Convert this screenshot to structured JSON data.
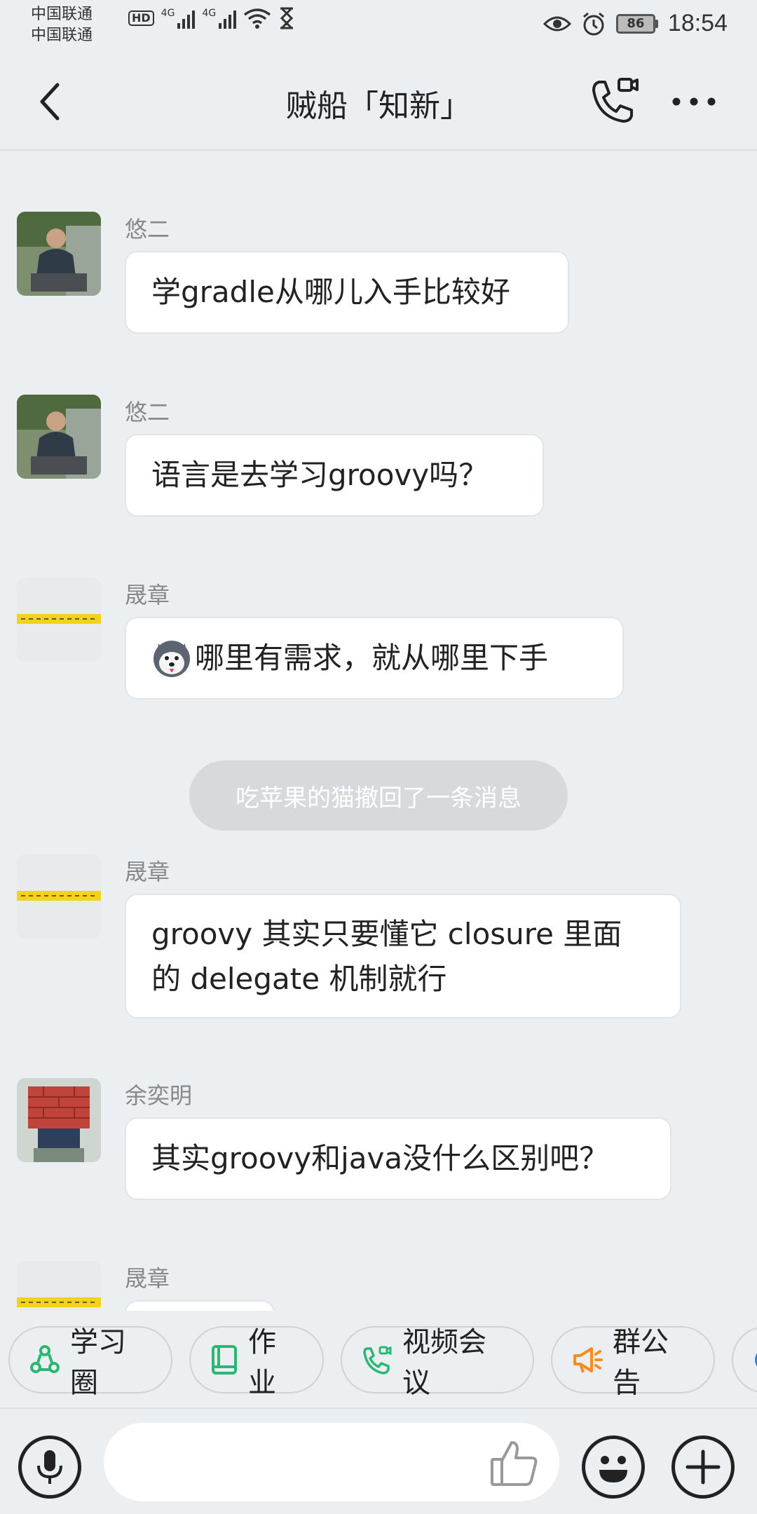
{
  "status_bar": {
    "carrier_1": "中国联通",
    "carrier_2": "中国联通",
    "hd": "HD",
    "net_1": "4G",
    "net_2": "4G",
    "battery": "86",
    "time": "18:54"
  },
  "header": {
    "title": "贼船「知新」"
  },
  "messages": [
    {
      "sender": "悠二",
      "text": "学gradle从哪儿入手比较好"
    },
    {
      "sender": "悠二",
      "text": "语言是去学习groovy吗？"
    },
    {
      "sender": "晟章",
      "text": "哪里有需求，就从哪里下手"
    },
    {
      "system": "吃苹果的猫撤回了一条消息"
    },
    {
      "sender": "晟章",
      "text_line1": "groovy 其实只要懂它 closure 里面",
      "text_line2": "的 delegate 机制就行"
    },
    {
      "sender": "余奕明",
      "text": "其实groovy和java没什么区别吧？"
    },
    {
      "sender": "晟章"
    }
  ],
  "tools": [
    {
      "label": "学习圈",
      "icon": "recycle-circle-icon",
      "color": "#2bb673"
    },
    {
      "label": "作业",
      "icon": "book-icon",
      "color": "#2bb673"
    },
    {
      "label": "视频会议",
      "icon": "video-call-icon",
      "color": "#2bb673"
    },
    {
      "label": "群公告",
      "icon": "megaphone-icon",
      "color": "#ff8a1e"
    }
  ],
  "input": {
    "placeholder": ""
  }
}
